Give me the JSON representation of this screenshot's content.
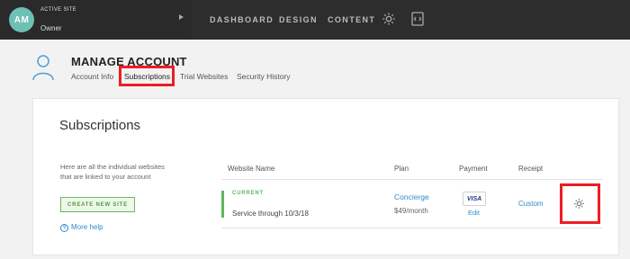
{
  "topbar": {
    "avatar_initials": "AM",
    "active_site_label": "ACTIVE SITE",
    "role": "Owner",
    "nav": [
      "DASHBOARD",
      "DESIGN",
      "CONTENT"
    ],
    "icons": [
      "settings-gear-icon",
      "code-editor-icon",
      "expand-arrow-icon"
    ]
  },
  "header": {
    "title": "MANAGE ACCOUNT",
    "tabs": [
      "Account Info",
      "Subscriptions",
      "Trial Websites",
      "Security History"
    ],
    "active_tab": "Subscriptions"
  },
  "main": {
    "title": "Subscriptions",
    "intro": "Here are all the individual websites that are linked to your account",
    "create_button": "CREATE NEW SITE",
    "help_link": "More help",
    "columns": [
      "Website Name",
      "Plan",
      "Payment",
      "Receipt"
    ],
    "row": {
      "status": "CURRENT",
      "service": "Service through 10/3/18",
      "plan_name": "Concierge",
      "plan_price": "$49/month",
      "card_brand": "VISA",
      "edit": "Edit",
      "receipt": "Custom"
    }
  },
  "colors": {
    "topbar": "#2d2d2d",
    "accent_blue": "#2e8bc9",
    "status_green": "#5cb85c",
    "highlight_red": "#ee1c25",
    "avatar": "#6cc0b4"
  }
}
